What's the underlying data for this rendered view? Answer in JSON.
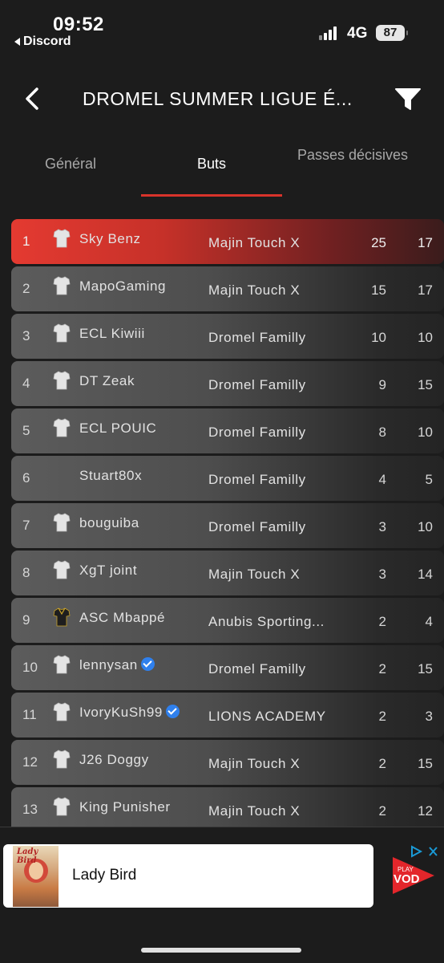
{
  "status_bar": {
    "time": "09:52",
    "back_app": "Discord",
    "network": "4G",
    "battery": "87"
  },
  "header": {
    "title": "DROMEL SUMMER LIGUE É...",
    "back_icon": "chevron-left-icon",
    "filter_icon": "filter-icon"
  },
  "tabs": [
    {
      "label": "Général",
      "active": false
    },
    {
      "label": "Buts",
      "active": true
    },
    {
      "label": "Passes décisives",
      "active": false
    }
  ],
  "accent_color": "#d8332b",
  "players": [
    {
      "rank": "1",
      "name": "Sky Benz",
      "team": "Majin Touch X",
      "goals": "25",
      "assists": "17",
      "jersey": "white",
      "verified": false
    },
    {
      "rank": "2",
      "name": "MapoGaming",
      "team": "Majin Touch X",
      "goals": "15",
      "assists": "17",
      "jersey": "white",
      "verified": false
    },
    {
      "rank": "3",
      "name": "ECL Kiwiii",
      "team": "Dromel Familly",
      "goals": "10",
      "assists": "10",
      "jersey": "white",
      "verified": false
    },
    {
      "rank": "4",
      "name": "DT Zeak",
      "team": "Dromel Familly",
      "goals": "9",
      "assists": "15",
      "jersey": "white",
      "verified": false
    },
    {
      "rank": "5",
      "name": "ECL POUIC",
      "team": "Dromel Familly",
      "goals": "8",
      "assists": "10",
      "jersey": "white",
      "verified": false
    },
    {
      "rank": "6",
      "name": "Stuart80x",
      "team": "Dromel Familly",
      "goals": "4",
      "assists": "5",
      "jersey": "none",
      "verified": false
    },
    {
      "rank": "7",
      "name": "bouguiba",
      "team": "Dromel Familly",
      "goals": "3",
      "assists": "10",
      "jersey": "white",
      "verified": false
    },
    {
      "rank": "8",
      "name": "XgT joint",
      "team": "Majin Touch X",
      "goals": "3",
      "assists": "14",
      "jersey": "white",
      "verified": false
    },
    {
      "rank": "9",
      "name": "ASC Mbappé",
      "team": "Anubis Sporting...",
      "goals": "2",
      "assists": "4",
      "jersey": "black",
      "verified": false
    },
    {
      "rank": "10",
      "name": "lennysan",
      "team": "Dromel Familly",
      "goals": "2",
      "assists": "15",
      "jersey": "white",
      "verified": true
    },
    {
      "rank": "11",
      "name": "IvoryKuSh99",
      "team": "LIONS ACADEMY",
      "goals": "2",
      "assists": "3",
      "jersey": "white",
      "verified": true
    },
    {
      "rank": "12",
      "name": "J26 Doggy",
      "team": "Majin Touch X",
      "goals": "2",
      "assists": "15",
      "jersey": "white",
      "verified": false
    },
    {
      "rank": "13",
      "name": "King Punisher",
      "team": "Majin Touch X",
      "goals": "2",
      "assists": "12",
      "jersey": "white",
      "verified": false
    }
  ],
  "ad": {
    "thumbnail_title": "Lady Bird",
    "text": "Lady Bird",
    "logo_text_top": "PLAY",
    "logo_text_bottom": "VOD"
  }
}
